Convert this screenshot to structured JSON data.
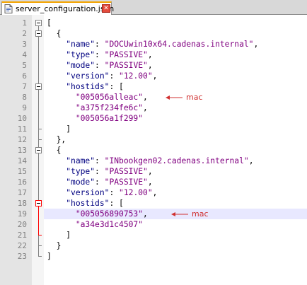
{
  "tab": {
    "title": "server_configuration.json",
    "close_label": "✕"
  },
  "lines": [
    {
      "n": "1",
      "parts": [
        [
          "p",
          "["
        ]
      ]
    },
    {
      "n": "2",
      "parts": [
        [
          "p",
          "  {"
        ]
      ]
    },
    {
      "n": "3",
      "parts": [
        [
          "p",
          "    "
        ],
        [
          "k",
          "\"name\""
        ],
        [
          "p",
          ": "
        ],
        [
          "s",
          "\"DOCUwin10x64.cadenas.internal\""
        ],
        [
          "p",
          ","
        ]
      ]
    },
    {
      "n": "4",
      "parts": [
        [
          "p",
          "    "
        ],
        [
          "k",
          "\"type\""
        ],
        [
          "p",
          ": "
        ],
        [
          "s",
          "\"PASSIVE\""
        ],
        [
          "p",
          ","
        ]
      ]
    },
    {
      "n": "5",
      "parts": [
        [
          "p",
          "    "
        ],
        [
          "k",
          "\"mode\""
        ],
        [
          "p",
          ": "
        ],
        [
          "s",
          "\"PASSIVE\""
        ],
        [
          "p",
          ","
        ]
      ]
    },
    {
      "n": "6",
      "parts": [
        [
          "p",
          "    "
        ],
        [
          "k",
          "\"version\""
        ],
        [
          "p",
          ": "
        ],
        [
          "s",
          "\"12.00\""
        ],
        [
          "p",
          ","
        ]
      ]
    },
    {
      "n": "7",
      "parts": [
        [
          "p",
          "    "
        ],
        [
          "k",
          "\"hostids\""
        ],
        [
          "p",
          ": ["
        ]
      ]
    },
    {
      "n": "8",
      "parts": [
        [
          "p",
          "      "
        ],
        [
          "s",
          "\"005056alleac\""
        ],
        [
          "p",
          ","
        ]
      ]
    },
    {
      "n": "9",
      "parts": [
        [
          "p",
          "      "
        ],
        [
          "s",
          "\"a375f234fe6c\""
        ],
        [
          "p",
          ","
        ]
      ]
    },
    {
      "n": "10",
      "parts": [
        [
          "p",
          "      "
        ],
        [
          "s",
          "\"005056a1f299\""
        ]
      ]
    },
    {
      "n": "11",
      "parts": [
        [
          "p",
          "    ]"
        ]
      ]
    },
    {
      "n": "12",
      "parts": [
        [
          "p",
          "  },"
        ]
      ]
    },
    {
      "n": "13",
      "parts": [
        [
          "p",
          "  {"
        ]
      ]
    },
    {
      "n": "14",
      "parts": [
        [
          "p",
          "    "
        ],
        [
          "k",
          "\"name\""
        ],
        [
          "p",
          ": "
        ],
        [
          "s",
          "\"INbookgen02.cadenas.internal\""
        ],
        [
          "p",
          ","
        ]
      ]
    },
    {
      "n": "15",
      "parts": [
        [
          "p",
          "    "
        ],
        [
          "k",
          "\"type\""
        ],
        [
          "p",
          ": "
        ],
        [
          "s",
          "\"PASSIVE\""
        ],
        [
          "p",
          ","
        ]
      ]
    },
    {
      "n": "16",
      "parts": [
        [
          "p",
          "    "
        ],
        [
          "k",
          "\"mode\""
        ],
        [
          "p",
          ": "
        ],
        [
          "s",
          "\"PASSIVE\""
        ],
        [
          "p",
          ","
        ]
      ]
    },
    {
      "n": "17",
      "parts": [
        [
          "p",
          "    "
        ],
        [
          "k",
          "\"version\""
        ],
        [
          "p",
          ": "
        ],
        [
          "s",
          "\"12.00\""
        ],
        [
          "p",
          ","
        ]
      ]
    },
    {
      "n": "18",
      "parts": [
        [
          "p",
          "    "
        ],
        [
          "k",
          "\"hostids\""
        ],
        [
          "p",
          ": ["
        ]
      ]
    },
    {
      "n": "19",
      "parts": [
        [
          "p",
          "      "
        ],
        [
          "s",
          "\"005056890753\""
        ],
        [
          "p",
          ","
        ]
      ]
    },
    {
      "n": "20",
      "parts": [
        [
          "p",
          "      "
        ],
        [
          "s",
          "\"a34e3d1c4507\""
        ]
      ]
    },
    {
      "n": "21",
      "parts": [
        [
          "p",
          "    ]"
        ]
      ]
    },
    {
      "n": "22",
      "parts": [
        [
          "p",
          "  }"
        ]
      ]
    },
    {
      "n": "23",
      "parts": [
        [
          "p",
          "]"
        ]
      ]
    }
  ],
  "annotations": [
    {
      "line": 8,
      "text": "mac"
    },
    {
      "line": 19,
      "text": "mac"
    }
  ],
  "highlighted_line": 19,
  "colors": {
    "key": "#000080",
    "string": "#800080",
    "annotation": "#d03030",
    "fold_active": "#ff0000"
  }
}
